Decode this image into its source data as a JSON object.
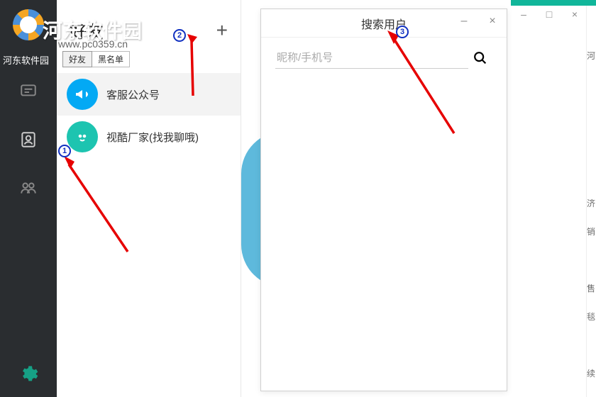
{
  "watermark": {
    "title": "河东软件园",
    "url": "www.pc0359.cn"
  },
  "sidebar": {
    "label": "河东软件园"
  },
  "friends": {
    "title": "好友",
    "tabs": [
      "好友",
      "黑名单"
    ],
    "contacts": [
      {
        "name": "客服公众号",
        "color": "blue"
      },
      {
        "name": "视酷厂家(找我聊哦)",
        "color": "teal"
      }
    ]
  },
  "search_dialog": {
    "title": "搜索用户",
    "placeholder": "昵称/手机号"
  },
  "badges": [
    "1",
    "2",
    "3"
  ],
  "right_chars": [
    "河",
    "济",
    "销",
    "售",
    "毯",
    "续"
  ],
  "window_controls": {
    "min": "–",
    "max": "□",
    "close": "×"
  }
}
